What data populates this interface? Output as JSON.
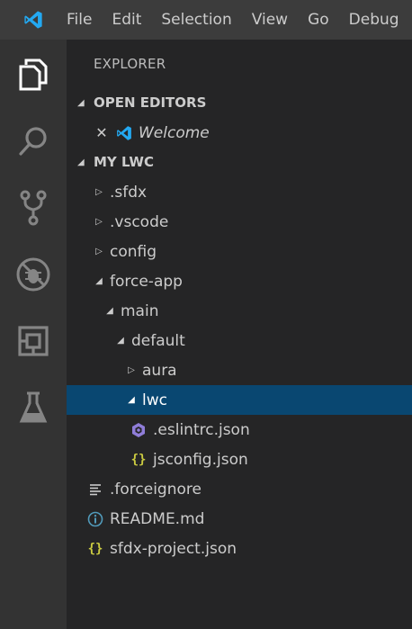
{
  "menubar": {
    "logo_icon": "vscode-logo-icon",
    "items": [
      "File",
      "Edit",
      "Selection",
      "View",
      "Go",
      "Debug"
    ]
  },
  "activitybar": {
    "icons": [
      "files-icon",
      "search-icon",
      "source-control-icon",
      "debug-icon",
      "extensions-icon",
      "test-flask-icon"
    ]
  },
  "explorer": {
    "title": "EXPLORER",
    "open_editors": {
      "header": "OPEN EDITORS",
      "items": [
        {
          "label": "Welcome",
          "icon": "vscode-logo-icon"
        }
      ]
    },
    "workspace": {
      "header": "MY LWC",
      "items": [
        {
          "label": ".sfdx",
          "kind": "folder",
          "expanded": false,
          "depth": 0
        },
        {
          "label": ".vscode",
          "kind": "folder",
          "expanded": false,
          "depth": 0
        },
        {
          "label": "config",
          "kind": "folder",
          "expanded": false,
          "depth": 0
        },
        {
          "label": "force-app",
          "kind": "folder",
          "expanded": true,
          "depth": 0
        },
        {
          "label": "main",
          "kind": "folder",
          "expanded": true,
          "depth": 1
        },
        {
          "label": "default",
          "kind": "folder",
          "expanded": true,
          "depth": 2
        },
        {
          "label": "aura",
          "kind": "folder",
          "expanded": false,
          "depth": 3
        },
        {
          "label": "lwc",
          "kind": "folder",
          "expanded": true,
          "depth": 3,
          "selected": true
        },
        {
          "label": ".eslintrc.json",
          "kind": "file",
          "icon": "eslint-icon",
          "depth": 4
        },
        {
          "label": "jsconfig.json",
          "kind": "file",
          "icon": "json-braces-icon",
          "depth": 4
        },
        {
          "label": ".forceignore",
          "kind": "file",
          "icon": "text-lines-icon",
          "depth": 0
        },
        {
          "label": "README.md",
          "kind": "file",
          "icon": "info-icon",
          "depth": 0
        },
        {
          "label": "sfdx-project.json",
          "kind": "file",
          "icon": "json-braces-icon",
          "depth": 0
        }
      ]
    }
  },
  "colors": {
    "selection": "#094771",
    "vscode_blue": "#23a9f2",
    "json_yellow": "#cbcb41",
    "eslint_purple": "#8f7dd8",
    "info_blue": "#519aba"
  }
}
